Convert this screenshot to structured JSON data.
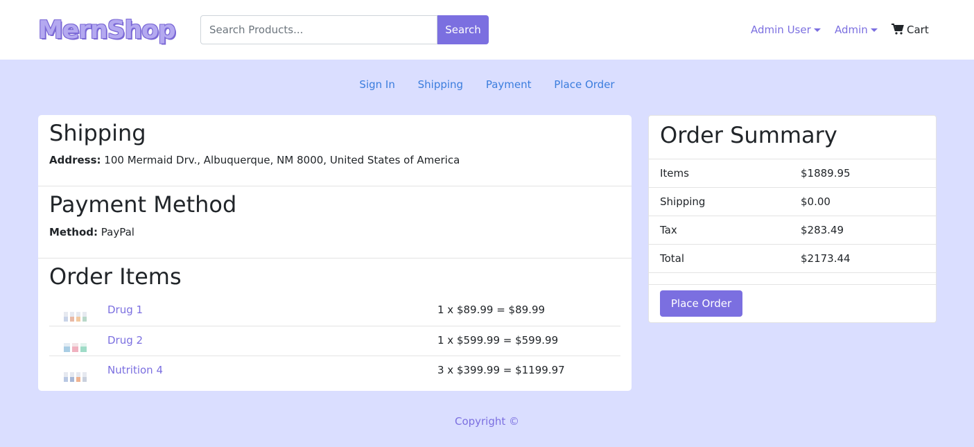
{
  "header": {
    "logo": "MernShop",
    "search_placeholder": "Search Products...",
    "search_button": "Search",
    "user_menu": "Admin User",
    "admin_menu": "Admin",
    "cart": "Cart"
  },
  "steps": [
    "Sign In",
    "Shipping",
    "Payment",
    "Place Order"
  ],
  "shipping": {
    "title": "Shipping",
    "address_label": "Address:",
    "address": "100 Mermaid Drv., Albuquerque, NM 8000, United States of America"
  },
  "payment": {
    "title": "Payment Method",
    "method_label": "Method:",
    "method": "PayPal"
  },
  "order_items": {
    "title": "Order Items",
    "items": [
      {
        "name": "Drug 1",
        "calc": "1 x $89.99 = $89.99"
      },
      {
        "name": "Drug 2",
        "calc": "1 x $599.99 = $599.99"
      },
      {
        "name": "Nutrition 4",
        "calc": "3 x $399.99 = $1199.97"
      }
    ]
  },
  "summary": {
    "title": "Order Summary",
    "rows": [
      {
        "label": "Items",
        "value": "$1889.95"
      },
      {
        "label": "Shipping",
        "value": "$0.00"
      },
      {
        "label": "Tax",
        "value": "$283.49"
      },
      {
        "label": "Total",
        "value": "$2173.44"
      }
    ],
    "place_order": "Place Order"
  },
  "footer": "Copyright ©",
  "colors": {
    "accent": "#7b6fe0",
    "background": "#dadeff",
    "link": "#3b7ddd"
  }
}
